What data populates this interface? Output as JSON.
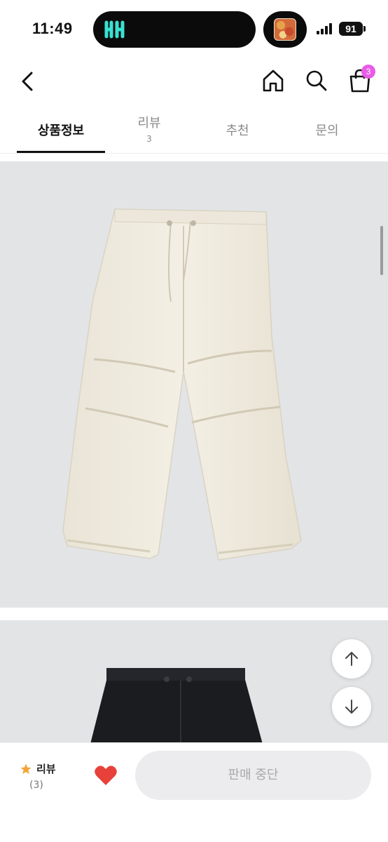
{
  "status_bar": {
    "time": "11:49",
    "battery": "91"
  },
  "header": {
    "back_icon": "chevron-left-icon",
    "home_icon": "home-icon",
    "search_icon": "search-icon",
    "cart_icon": "shopping-bag-icon",
    "cart_count": "3",
    "badge_color": "#e95be7"
  },
  "tabs": [
    {
      "label": "상품정보",
      "count": "",
      "active": true
    },
    {
      "label": "리뷰",
      "count": "3",
      "active": false
    },
    {
      "label": "추천",
      "count": "",
      "active": false
    },
    {
      "label": "문의",
      "count": "",
      "active": false
    }
  ],
  "floating_buttons": {
    "up_icon": "arrow-up-icon",
    "down_icon": "arrow-down-icon"
  },
  "bottom_bar": {
    "rating_icon": "star-icon",
    "rating_label": "리뷰",
    "rating_count": "(3)",
    "like_icon": "heart-icon",
    "like_color": "#e8413a",
    "status_button": "판매 중단"
  }
}
